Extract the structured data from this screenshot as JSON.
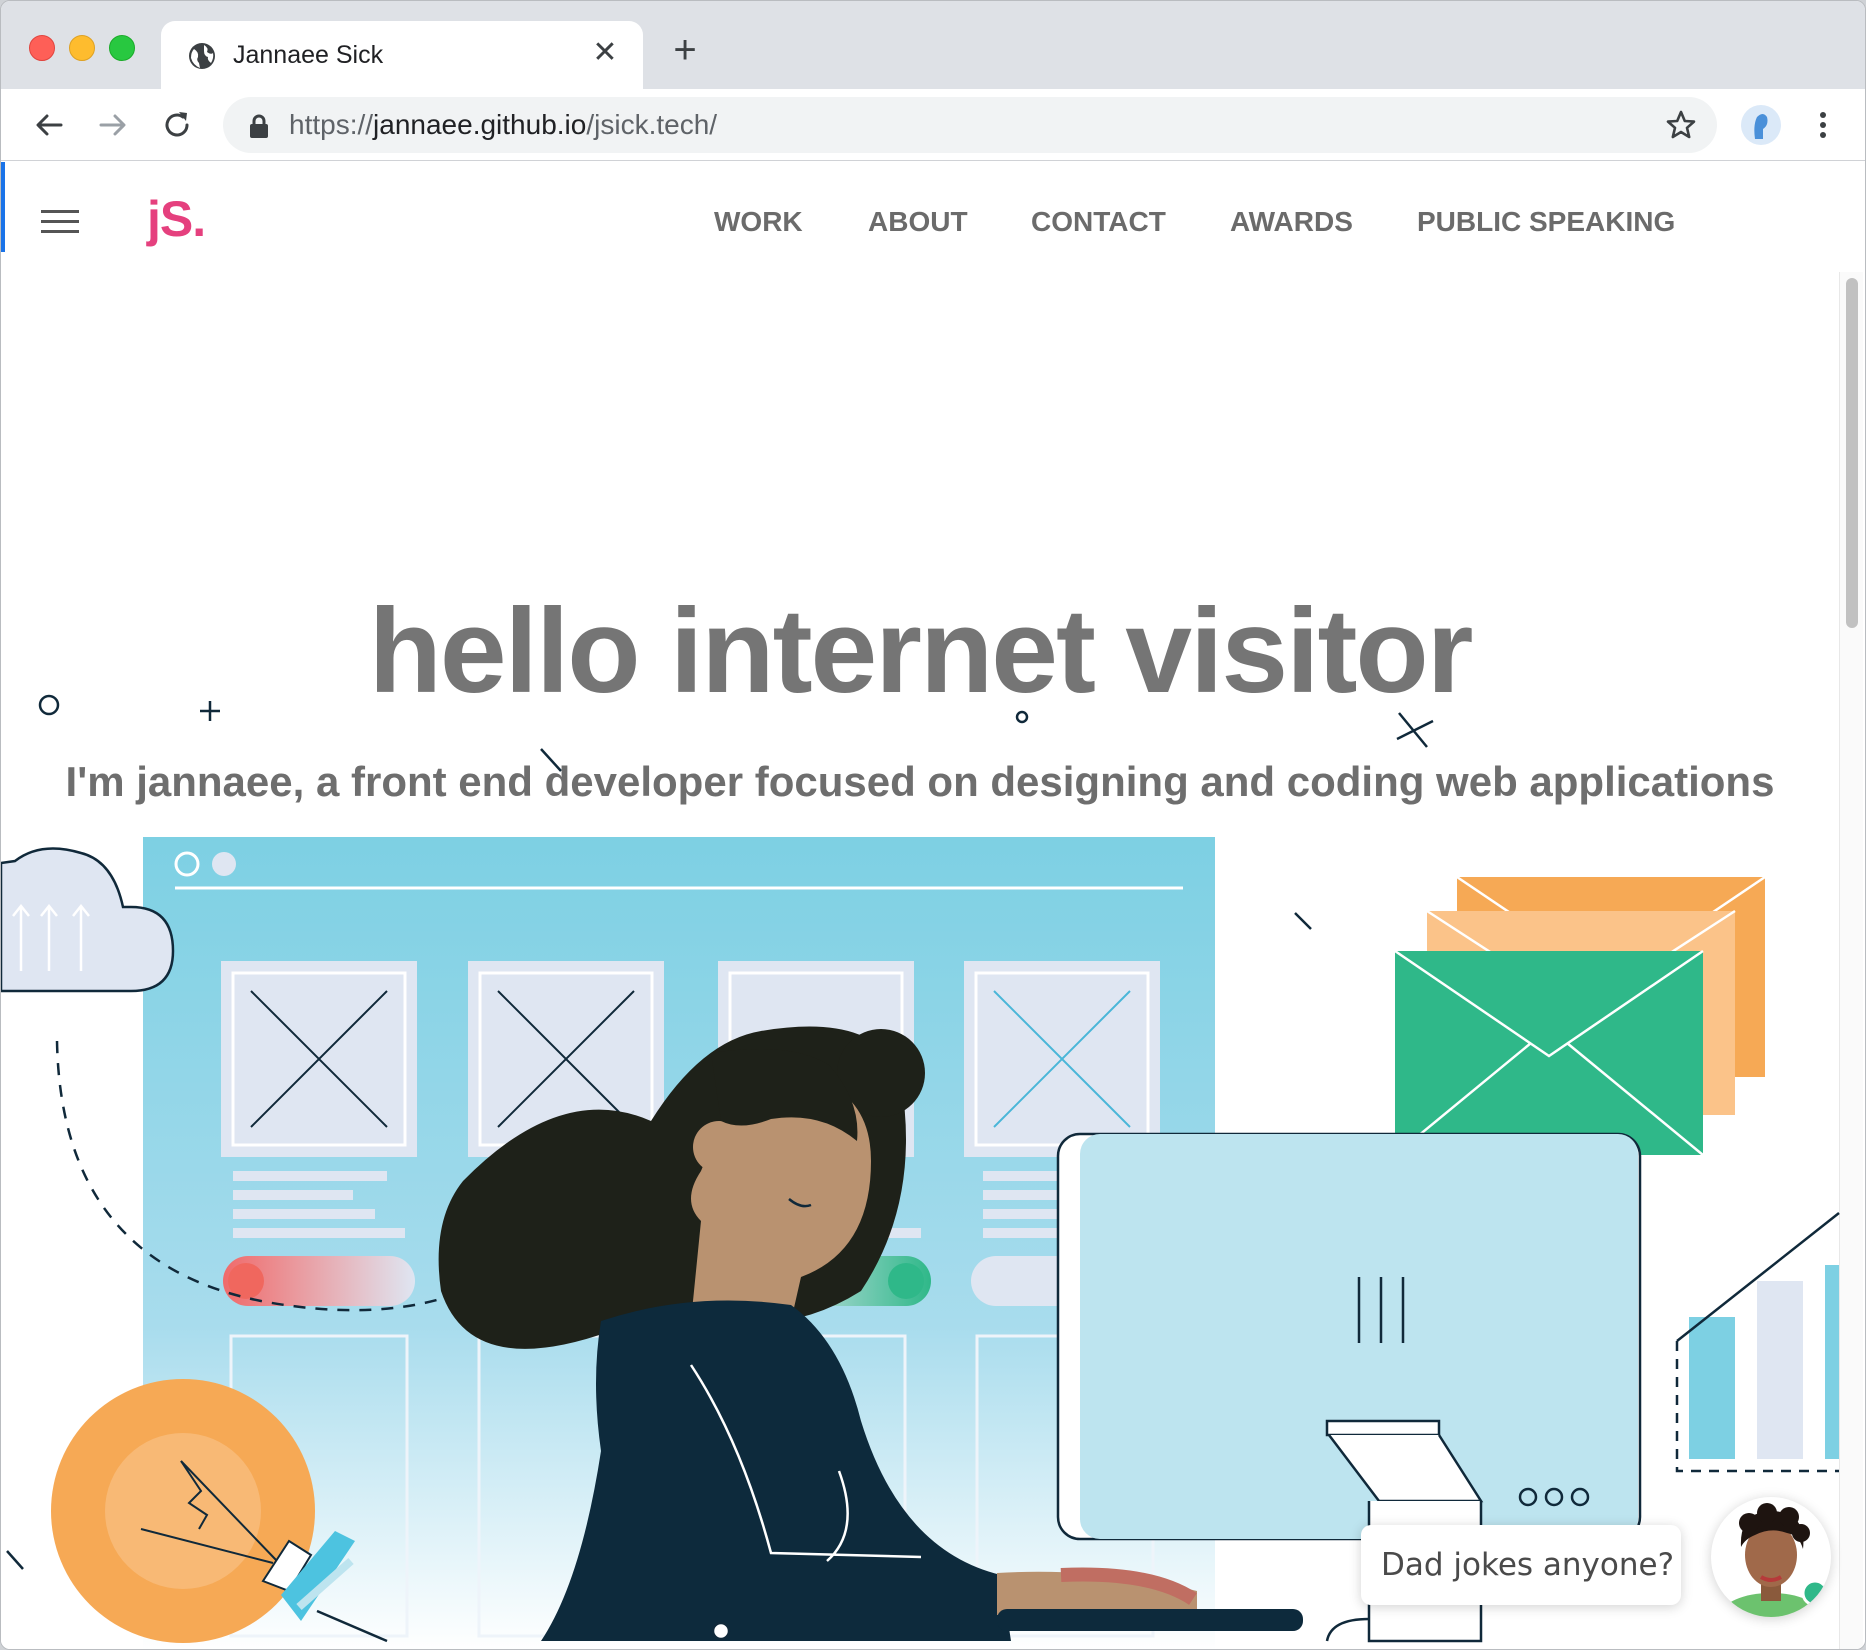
{
  "browser": {
    "tab_title": "Jannaee Sick",
    "url_scheme": "https://",
    "url_host": "jannaee.github.io",
    "url_path": "/jsick.tech/"
  },
  "site": {
    "logo": "jS.",
    "nav": [
      "WORK",
      "ABOUT",
      "CONTACT",
      "AWARDS",
      "PUBLIC SPEAKING"
    ],
    "hero_title": "hello internet visitor",
    "hero_subtitle": "I'm jannaee, a front end developer focused on designing and coding web applications",
    "chat_prompt": "Dad jokes anyone?"
  },
  "colors": {
    "logo": "#e5407e",
    "nav_text": "#6b6b6b",
    "hero_text": "#757575",
    "sky_blue": "#7dd0e3",
    "green": "#2fb889",
    "orange": "#f6a955",
    "navy": "#0d2a3c"
  },
  "icons": [
    "globe-icon",
    "close-icon",
    "plus-icon",
    "back-arrow-icon",
    "forward-arrow-icon",
    "reload-icon",
    "lock-icon",
    "star-icon",
    "profile-icon",
    "more-vert-icon",
    "hamburger-icon"
  ]
}
